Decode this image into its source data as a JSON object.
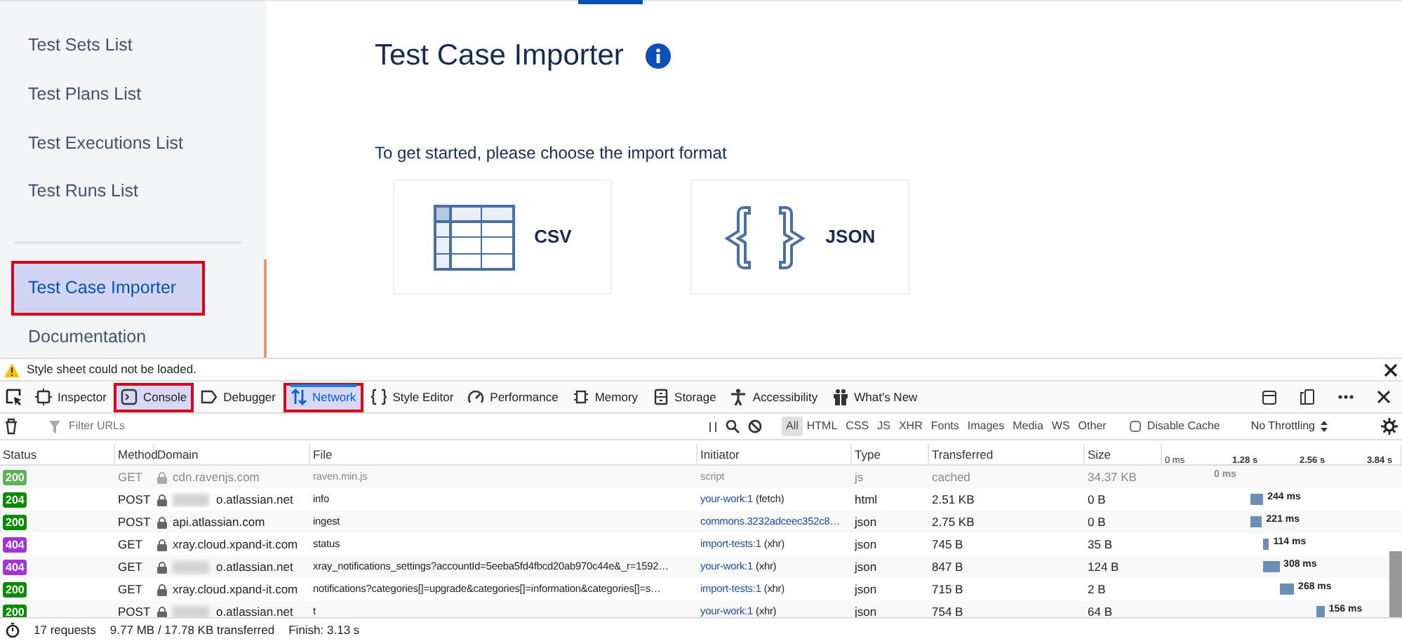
{
  "sidebar": {
    "items": [
      {
        "label": "Test Sets List",
        "selected": false,
        "highlighted": false
      },
      {
        "label": "Test Plans List",
        "selected": false,
        "highlighted": false
      },
      {
        "label": "Test Executions List",
        "selected": false,
        "highlighted": false
      },
      {
        "label": "Test Runs List",
        "selected": false,
        "highlighted": false
      },
      {
        "label": "Test Case Importer",
        "selected": true,
        "highlighted": true
      },
      {
        "label": "Documentation",
        "selected": false,
        "highlighted": false
      }
    ]
  },
  "main": {
    "title": "Test Case Importer",
    "intro": "To get started, please choose the import format",
    "formats": [
      {
        "kind": "csv",
        "label": "CSV"
      },
      {
        "kind": "json",
        "label": "JSON"
      }
    ]
  },
  "devtools": {
    "warning": "Style sheet could not be loaded.",
    "tools": [
      {
        "kind": "inspector",
        "label": "Inspector",
        "selected": false,
        "highlighted": false
      },
      {
        "kind": "console",
        "label": "Console",
        "selected": false,
        "highlighted": true
      },
      {
        "kind": "debugger",
        "label": "Debugger",
        "selected": false,
        "highlighted": false
      },
      {
        "kind": "network",
        "label": "Network",
        "selected": true,
        "highlighted": true
      },
      {
        "kind": "style",
        "label": "Style Editor",
        "selected": false,
        "highlighted": false
      },
      {
        "kind": "performance",
        "label": "Performance",
        "selected": false,
        "highlighted": false
      },
      {
        "kind": "memory",
        "label": "Memory",
        "selected": false,
        "highlighted": false
      },
      {
        "kind": "storage",
        "label": "Storage",
        "selected": false,
        "highlighted": false
      },
      {
        "kind": "accessibility",
        "label": "Accessibility",
        "selected": false,
        "highlighted": false
      },
      {
        "kind": "whatsnew",
        "label": "What's New",
        "selected": false,
        "highlighted": false
      }
    ],
    "filter": {
      "placeholder": "Filter URLs"
    },
    "types": [
      {
        "label": "All",
        "selected": true
      },
      {
        "label": "HTML",
        "selected": false
      },
      {
        "label": "CSS",
        "selected": false
      },
      {
        "label": "JS",
        "selected": false
      },
      {
        "label": "XHR",
        "selected": false
      },
      {
        "label": "Fonts",
        "selected": false
      },
      {
        "label": "Images",
        "selected": false
      },
      {
        "label": "Media",
        "selected": false
      },
      {
        "label": "WS",
        "selected": false
      },
      {
        "label": "Other",
        "selected": false
      }
    ],
    "disable_cache": {
      "label": "Disable Cache",
      "checked": false
    },
    "throttling": "No Throttling",
    "columns": [
      "Status",
      "Method",
      "Domain",
      "File",
      "Initiator",
      "Type",
      "Transferred",
      "Size"
    ],
    "timeline_ticks": [
      "0 ms",
      "1.28 s",
      "2.56 s",
      "3.84 s"
    ],
    "rows": [
      {
        "status": "200",
        "color": "#5fb15a",
        "cached": true,
        "method": "GET",
        "domain": "cdn.ravenjs.com",
        "redacted": false,
        "file": "raven.min.js",
        "initiator": "script",
        "type": "js",
        "transferred": "cached",
        "size": "34.37 KB",
        "time": "0 ms"
      },
      {
        "status": "204",
        "color": "#0a8a00",
        "cached": false,
        "method": "POST",
        "domain": "o.atlassian.net",
        "redacted": true,
        "file": "info",
        "initiator_link": "your-work:1",
        "initiator_note": "(fetch)",
        "type": "html",
        "transferred": "2.51 KB",
        "size": "0 B",
        "time": "244 ms"
      },
      {
        "status": "200",
        "color": "#0a8a00",
        "cached": false,
        "method": "POST",
        "domain": "api.atlassian.com",
        "redacted": false,
        "file": "ingest",
        "initiator_link": "commons.3232adceec352c8…",
        "type": "json",
        "transferred": "2.75 KB",
        "size": "0 B",
        "time": "221 ms"
      },
      {
        "status": "404",
        "color": "#a333d8",
        "cached": false,
        "method": "GET",
        "domain": "xray.cloud.xpand-it.com",
        "redacted": false,
        "file": "status",
        "initiator_link": "import-tests:1",
        "initiator_note": "(xhr)",
        "type": "json",
        "transferred": "745 B",
        "size": "35 B",
        "time": "114 ms"
      },
      {
        "status": "404",
        "color": "#a333d8",
        "cached": false,
        "method": "GET",
        "domain": "o.atlassian.net",
        "redacted": true,
        "file": "xray_notifications_settings?accountId=5eeba5fd4fbcd20ab970c44e&_r=1592…",
        "initiator_link": "your-work:1",
        "initiator_note": "(xhr)",
        "type": "json",
        "transferred": "847 B",
        "size": "124 B",
        "time": "308 ms"
      },
      {
        "status": "200",
        "color": "#0a8a00",
        "cached": false,
        "method": "GET",
        "domain": "xray.cloud.xpand-it.com",
        "redacted": false,
        "file": "notifications?categories[]=upgrade&categories[]=information&categories[]=s…",
        "initiator_link": "import-tests:1",
        "initiator_note": "(xhr)",
        "type": "json",
        "transferred": "715 B",
        "size": "2 B",
        "time": "268 ms"
      },
      {
        "status": "200",
        "color": "#0a8a00",
        "cached": false,
        "method": "POST",
        "domain": "o.atlassian.net",
        "redacted": true,
        "file": "t",
        "initiator_link": "your-work:1",
        "initiator_note": "(xhr)",
        "type": "json",
        "transferred": "754 B",
        "size": "64 B",
        "time": "156 ms"
      }
    ],
    "summary": [
      "17 requests",
      "9.77 MB / 17.78 KB transferred",
      "Finish: 3.13 s"
    ]
  }
}
